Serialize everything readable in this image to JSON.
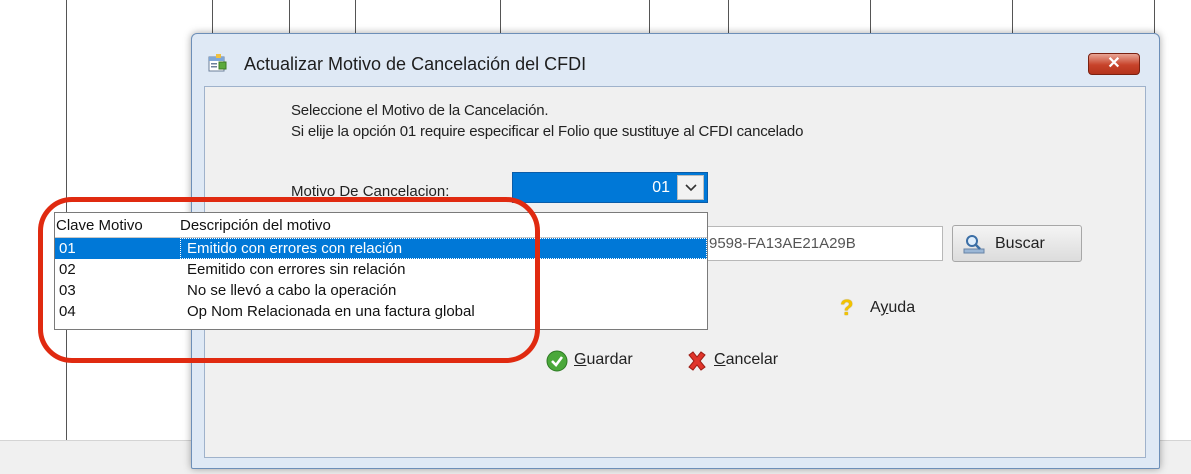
{
  "dialog": {
    "title": "Actualizar Motivo de Cancelación del CFDI",
    "close_label": "✕",
    "instruction_line1": "Seleccione el Motivo de la Cancelación.",
    "instruction_line2": "Si elije la opción 01 require especificar el Folio que sustituye al CFDI cancelado",
    "motivo_label": "Motivo De Cancelacion:",
    "motivo_selected": "01",
    "folio_value": "9598-FA13AE21A29B",
    "buscar_label": "Buscar",
    "ayuda_label_prefix": "A",
    "ayuda_label_underline": "y",
    "ayuda_label_rest": "uda",
    "guardar_underline": "G",
    "guardar_rest": "uardar",
    "cancelar_underline": "C",
    "cancelar_rest": "ancelar"
  },
  "dropdown": {
    "headers": [
      "Clave Motivo",
      "Descripción del motivo"
    ],
    "rows": [
      {
        "clave": "01",
        "descripcion": "Emitido con errores con relación",
        "selected": true
      },
      {
        "clave": "02",
        "descripcion": "Eemitido con errores sin relación",
        "selected": false
      },
      {
        "clave": "03",
        "descripcion": "No se llevó a cabo la operación",
        "selected": false
      },
      {
        "clave": "04",
        "descripcion": "Op Nom Relacionada en una factura global",
        "selected": false
      }
    ]
  },
  "colors": {
    "selection": "#0078d7",
    "annotation": "#e02a10",
    "close_button": "#c7432a"
  },
  "icons": [
    "app-form-icon",
    "close-icon",
    "search-magnifier-icon",
    "help-question-icon",
    "check-icon",
    "x-cancel-icon",
    "chevron-down-icon"
  ]
}
